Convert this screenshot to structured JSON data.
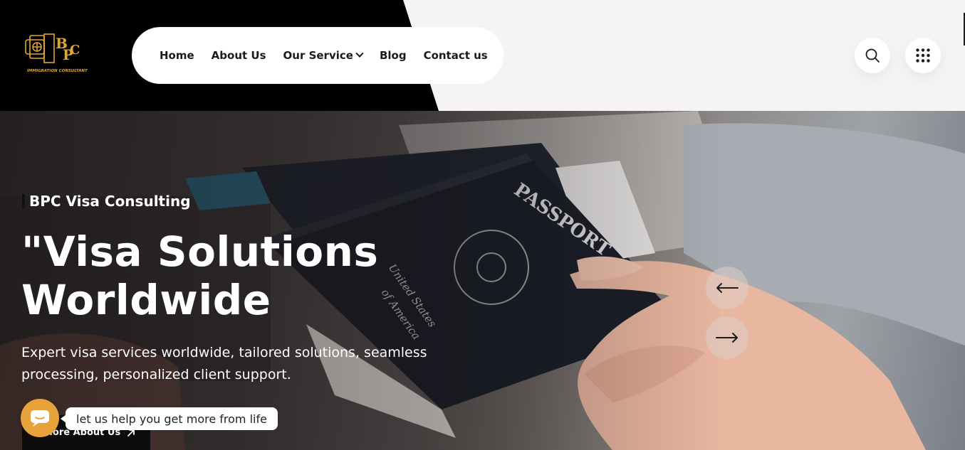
{
  "brand": {
    "logo_alt": "BPC Immigration Consultant",
    "logo_text": "BPC",
    "logo_tagline": "IMMIGRATION CONSULTANT",
    "accent_color": "#e3a72b"
  },
  "nav": {
    "items": [
      {
        "label": "Home"
      },
      {
        "label": "About Us"
      },
      {
        "label": "Our Service",
        "has_dropdown": true
      },
      {
        "label": "Blog"
      },
      {
        "label": "Contact us"
      }
    ]
  },
  "header_actions": {
    "search_icon": "search-icon",
    "menu_icon": "grid-menu-icon"
  },
  "hero": {
    "eyebrow": "BPC Visa Consulting",
    "headline_line1": "\"Visa Solutions",
    "headline_line2": "Worldwide",
    "subtext_line1": "Expert visa services worldwide, tailored solutions, seamless",
    "subtext_line2": "processing, personalized client support.",
    "cta_label": "More About Us",
    "prev_icon": "arrow-left-icon",
    "next_icon": "arrow-right-icon"
  },
  "chat": {
    "tooltip": "let us help you get more from life",
    "icon": "chat-icon",
    "color": "#e8a23a"
  }
}
